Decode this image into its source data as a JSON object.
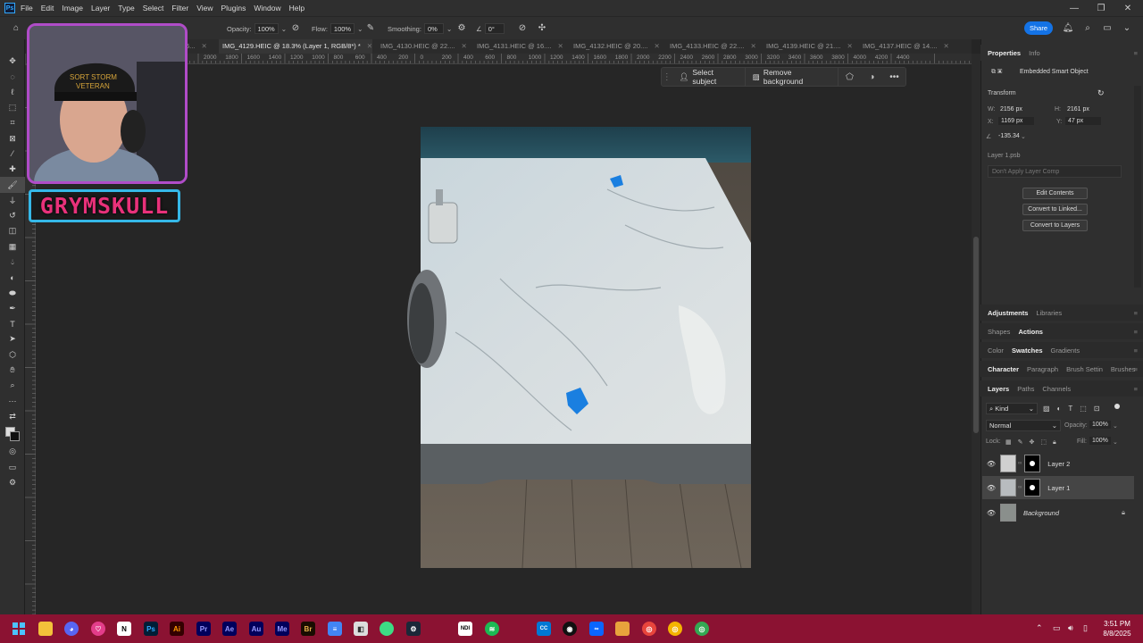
{
  "app": {
    "logo_text": "Ps"
  },
  "menu": [
    "File",
    "Edit",
    "Image",
    "Layer",
    "Type",
    "Select",
    "Filter",
    "View",
    "Plugins",
    "Window",
    "Help"
  ],
  "window_controls": [
    "—",
    "❐",
    "✕"
  ],
  "options": {
    "opacity_label": "Opacity:",
    "opacity_value": "100%",
    "flow_label": "Flow:",
    "flow_value": "100%",
    "smoothing_label": "Smoothing:",
    "smoothing_value": "0%",
    "angle_value": "0°",
    "share_label": "Share"
  },
  "tabs": [
    {
      "label": "6..."
    },
    {
      "label": "IMG_4129.HEIC @ 18.3% (Layer 1, RGB/8*) *"
    },
    {
      "label": "IMG_4130.HEIC @ 22...."
    },
    {
      "label": "IMG_4131.HEIC @ 16...."
    },
    {
      "label": "IMG_4132.HEIC @ 20...."
    },
    {
      "label": "IMG_4133.HEIC @ 22...."
    },
    {
      "label": "IMG_4139.HEIC @ 21...."
    },
    {
      "label": "IMG_4137.HEIC @ 14...."
    }
  ],
  "ruler_labels": [
    "2000",
    "1800",
    "1600",
    "1400",
    "1200",
    "1000",
    "800",
    "600",
    "400",
    "200",
    "0",
    "200",
    "400",
    "600",
    "800",
    "1000",
    "1200",
    "1400",
    "1600",
    "1800",
    "2000",
    "2200",
    "2400",
    "2600",
    "2800",
    "3000",
    "3200",
    "3400",
    "3600",
    "3800",
    "4000",
    "4200",
    "4400"
  ],
  "context_bar": {
    "select_subject": "Select subject",
    "remove_background": "Remove background",
    "more": "•••"
  },
  "webcam": {
    "name": "GRYMSKULL"
  },
  "properties": {
    "tabs": [
      "Properties",
      "Info"
    ],
    "object_type": "Embedded Smart Object",
    "transform_label": "Transform",
    "w_label": "W:",
    "w_value": "2156 px",
    "h_label": "H:",
    "h_value": "2161 px",
    "x_label": "X:",
    "x_value": "1169 px",
    "y_label": "Y:",
    "y_value": "47 px",
    "angle_value": "-135.34",
    "linked_file": "Layer 1.psb",
    "layer_comp": "Don't Apply Layer Comp",
    "buttons": [
      "Edit Contents",
      "Convert to Linked...",
      "Convert to Layers"
    ]
  },
  "panel_groups": [
    {
      "tabs": [
        "Adjustments",
        "Libraries"
      ],
      "active": 0
    },
    {
      "tabs": [
        "Shapes",
        "Actions"
      ],
      "active": 1
    },
    {
      "tabs": [
        "Color",
        "Swatches",
        "Gradients"
      ],
      "active": 1
    },
    {
      "tabs": [
        "Character",
        "Paragraph",
        "Brush Settin",
        "Brushes"
      ],
      "active": 0
    },
    {
      "tabs": [
        "Layers",
        "Paths",
        "Channels"
      ],
      "active": 0
    }
  ],
  "layers_panel": {
    "filter": "Kind",
    "blend_mode": "Normal",
    "opacity_label": "Opacity:",
    "opacity_value": "100%",
    "lock_label": "Lock:",
    "fill_label": "Fill:",
    "fill_value": "100%",
    "layers": [
      {
        "name": "Layer 2",
        "selected": false
      },
      {
        "name": "Layer 1",
        "selected": true
      },
      {
        "name": "Background",
        "selected": false,
        "locked": true
      }
    ]
  },
  "taskbar": {
    "apps": [
      "windows-start",
      "file-explorer",
      "discord",
      "app-pink",
      "notion",
      "photoshop",
      "illustrator",
      "premiere",
      "after-effects",
      "audition",
      "media-encoder",
      "bridge",
      "docs",
      "app-grey",
      "android",
      "steam",
      "ndi",
      "spotify",
      "cc",
      "obs",
      "meta",
      "folder",
      "chrome",
      "chrome-2",
      "chrome-3"
    ],
    "time": "3:51 PM",
    "date": "8/8/2025"
  }
}
